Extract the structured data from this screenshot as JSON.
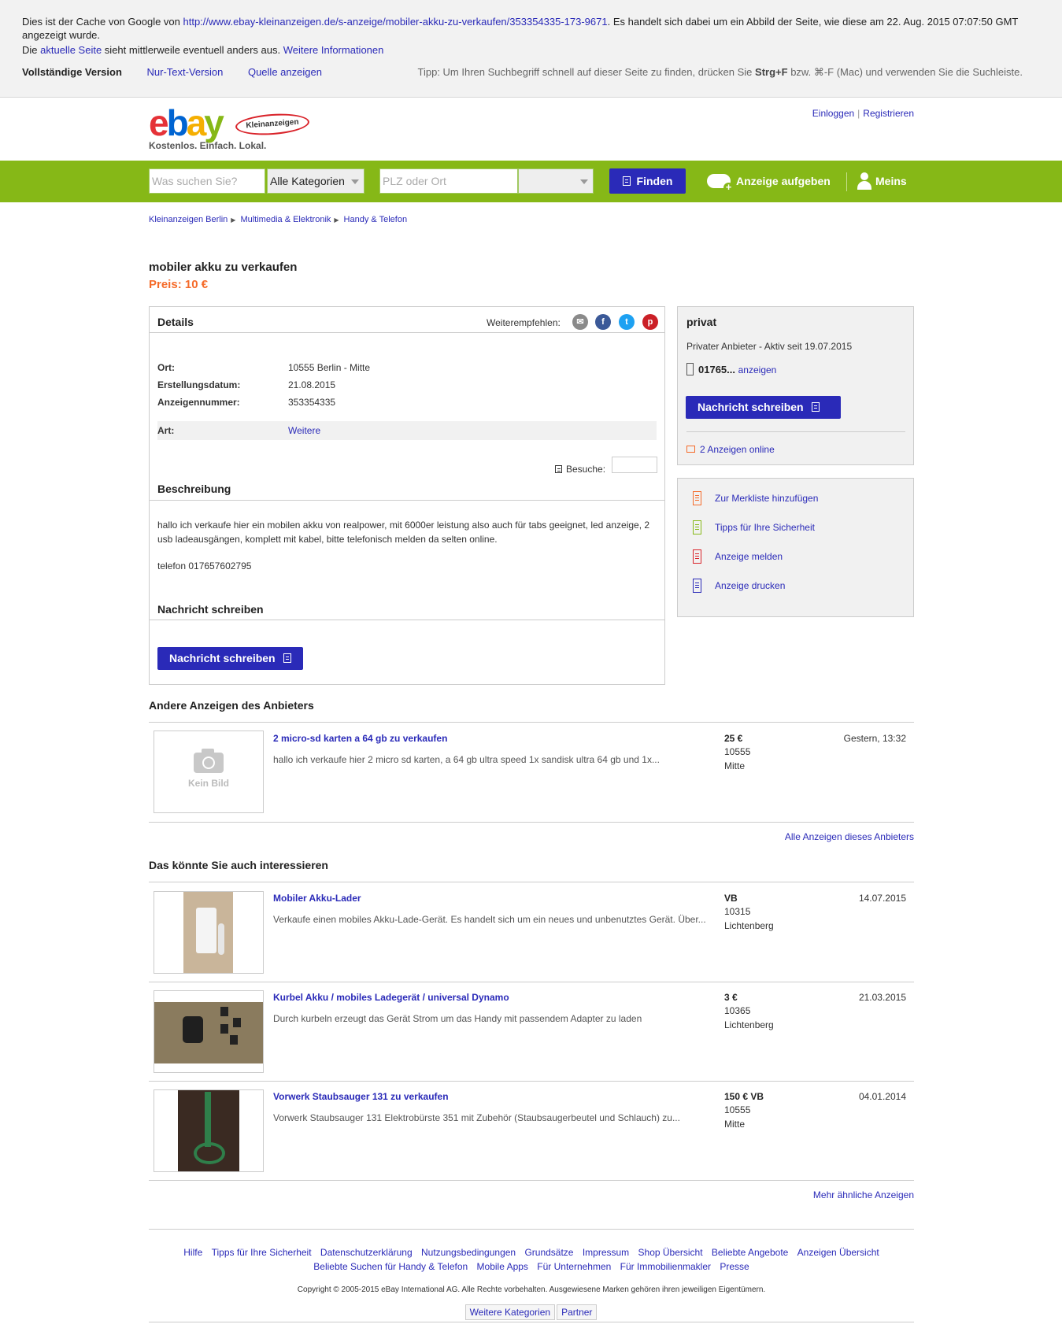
{
  "cache": {
    "line1_a": "Dies ist der Cache von Google von ",
    "url": "http://www.ebay-kleinanzeigen.de/s-anzeige/mobiler-akku-zu-verkaufen/353354335-173-9671",
    "line1_b": ". Es handelt sich dabei um ein Abbild der Seite, wie diese am 22. Aug. 2015 07:07:50 GMT angezeigt wurde.",
    "line2_a": "Die ",
    "aktuelle_seite": "aktuelle Seite",
    "line2_b": " sieht mittlerweile eventuell anders aus. ",
    "weitere_info": "Weitere Informationen",
    "full_version": "Vollständige Version",
    "text_version": "Nur-Text-Version",
    "source": "Quelle anzeigen",
    "tip_a": "Tipp: Um Ihren Suchbegriff schnell auf dieser Seite zu finden, drücken Sie ",
    "tip_keys": "Strg+F",
    "tip_b": " bzw. ⌘-F (Mac) und verwenden Sie die Suchleiste."
  },
  "header": {
    "logo_kleinanzeigen": "Kleinanzeigen",
    "tagline": "Kostenlos. Einfach. Lokal.",
    "login": "Einloggen",
    "separator": "|",
    "register": "Registrieren"
  },
  "search": {
    "query_placeholder": "Was suchen Sie?",
    "category": "Alle Kategorien",
    "location_placeholder": "PLZ oder Ort",
    "find_button": "Finden",
    "post_ad": "Anzeige aufgeben",
    "my_account": "Meins"
  },
  "breadcrumb": [
    "Kleinanzeigen Berlin",
    "Multimedia & Elektronik",
    "Handy & Telefon"
  ],
  "listing": {
    "title": "mobiler akku zu verkaufen",
    "price": "Preis: 10 €",
    "details_heading": "Details",
    "share_label": "Weiterempfehlen:",
    "fields": [
      {
        "key": "Ort:",
        "value": "10555 Berlin - Mitte"
      },
      {
        "key": "Erstellungsdatum:",
        "value": "21.08.2015"
      },
      {
        "key": "Anzeigennummer:",
        "value": "353354335"
      }
    ],
    "art_key": "Art:",
    "art_value": "Weitere",
    "visits_label": "Besuche:",
    "description_heading": "Beschreibung",
    "description": "hallo ich verkaufe hier ein mobilen akku von realpower, mit 6000er leistung also auch für tabs geeignet, led anzeige, 2 usb ladeausgängen, komplett mit kabel, bitte telefonisch melden da selten online.",
    "phone_line": "telefon 017657602795",
    "message_heading": "Nachricht schreiben",
    "message_button": "Nachricht schreiben"
  },
  "seller": {
    "type": "privat",
    "since": "Privater Anbieter - Aktiv seit 19.07.2015",
    "phone": "01765...",
    "show_phone": "anzeigen",
    "message_button": "Nachricht schreiben",
    "ads_online": "2 Anzeigen online"
  },
  "actions": [
    "Zur Merkliste hinzufügen",
    "Tipps für Ihre Sicherheit",
    "Anzeige melden",
    "Anzeige drucken"
  ],
  "other_ads": {
    "heading": "Andere Anzeigen des Anbieters",
    "no_image": "Kein Bild",
    "items": [
      {
        "title": "2 micro-sd karten a 64 gb zu verkaufen",
        "desc": "hallo ich verkaufe hier 2 micro sd karten, a 64 gb ultra speed 1x sandisk ultra 64 gb und 1x...",
        "price": "25 €",
        "zip": "10555",
        "district": "Mitte",
        "date": "Gestern, 13:32"
      }
    ],
    "all_link": "Alle Anzeigen dieses Anbieters"
  },
  "related": {
    "heading": "Das könnte Sie auch interessieren",
    "items": [
      {
        "title": "Mobiler Akku-Lader",
        "desc": "Verkaufe einen mobiles Akku-Lade-Gerät. Es handelt sich um ein neues und unbenutztes Gerät. Über...",
        "price": "VB",
        "zip": "10315",
        "district": "Lichtenberg",
        "date": "14.07.2015"
      },
      {
        "title": "Kurbel Akku / mobiles Ladegerät / universal Dynamo",
        "desc": "Durch kurbeln erzeugt das Gerät Strom um das Handy mit passendem Adapter zu laden",
        "price": "3 €",
        "zip": "10365",
        "district": "Lichtenberg",
        "date": "21.03.2015"
      },
      {
        "title": "Vorwerk Staubsauger 131 zu verkaufen",
        "desc": "Vorwerk Staubsauger 131 Elektrobürste 351 mit Zubehör (Staubsaugerbeutel und Schlauch) zu...",
        "price": "150 € VB",
        "zip": "10555",
        "district": "Mitte",
        "date": "04.01.2014"
      }
    ],
    "more_link": "Mehr ähnliche Anzeigen"
  },
  "footer": {
    "links_row1": [
      "Hilfe",
      "Tipps für Ihre Sicherheit",
      "Datenschutzerklärung",
      "Nutzungsbedingungen",
      "Grundsätze",
      "Impressum",
      "Shop Übersicht",
      "Beliebte Angebote",
      "Anzeigen Übersicht"
    ],
    "links_row2": [
      "Beliebte Suchen für Handy & Telefon",
      "Mobile Apps",
      "Für Unternehmen",
      "Für Immobilienmakler",
      "Presse"
    ],
    "copyright": "Copyright © 2005-2015 eBay International AG. Alle Rechte vorbehalten. Ausgewiesene Marken gehören ihren jeweiligen Eigentümern.",
    "tabs": [
      "Weitere Kategorien",
      "Partner"
    ]
  },
  "colors": {
    "brand_green": "#86b817",
    "button_blue": "#2a2ab8",
    "price_orange": "#f56b2a"
  }
}
